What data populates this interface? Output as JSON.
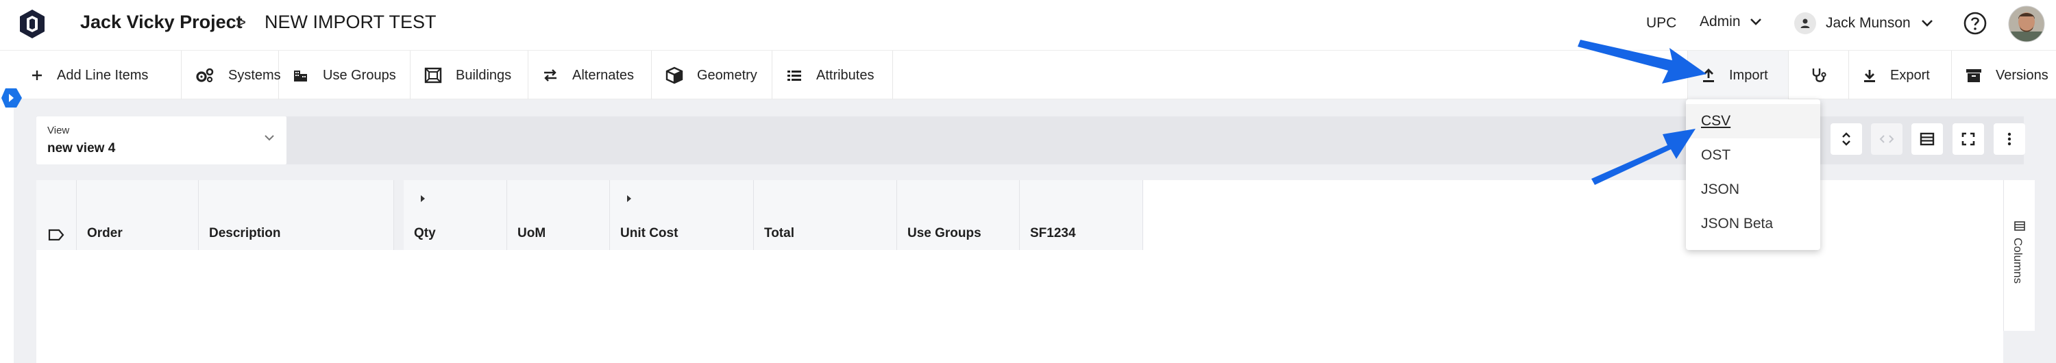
{
  "header": {
    "project": "Jack Vicky Project",
    "separator": ">",
    "current": "NEW IMPORT TEST",
    "upc": "UPC",
    "role": "Admin",
    "user_name": "Jack Munson"
  },
  "toolbar": {
    "items": [
      {
        "label": "Add Line Items",
        "icon": "plus-icon"
      },
      {
        "label": "Systems",
        "icon": "gears-icon"
      },
      {
        "label": "Use Groups",
        "icon": "buildings-icon"
      },
      {
        "label": "Buildings",
        "icon": "floorplan-icon"
      },
      {
        "label": "Alternates",
        "icon": "swap-icon"
      },
      {
        "label": "Geometry",
        "icon": "cube-icon"
      },
      {
        "label": "Attributes",
        "icon": "list-icon"
      },
      {
        "label": "Import",
        "icon": "upload-icon"
      },
      {
        "label": "Export",
        "icon": "download-icon"
      },
      {
        "label": "Versions",
        "icon": "archive-icon"
      }
    ]
  },
  "view": {
    "label": "View",
    "value": "new view 4"
  },
  "grid": {
    "columns": [
      "Order",
      "Description",
      "Qty",
      "UoM",
      "Unit Cost",
      "Total",
      "Use Groups",
      "SF1234"
    ]
  },
  "side_panel": {
    "label": "Columns"
  },
  "import_menu": {
    "options": [
      "CSV",
      "OST",
      "JSON",
      "JSON Beta"
    ],
    "hovered": "CSV"
  },
  "colors": {
    "accent": "#1a73e8",
    "annotation_arrow": "#1565e6",
    "panel_bg": "#eff0f3"
  }
}
